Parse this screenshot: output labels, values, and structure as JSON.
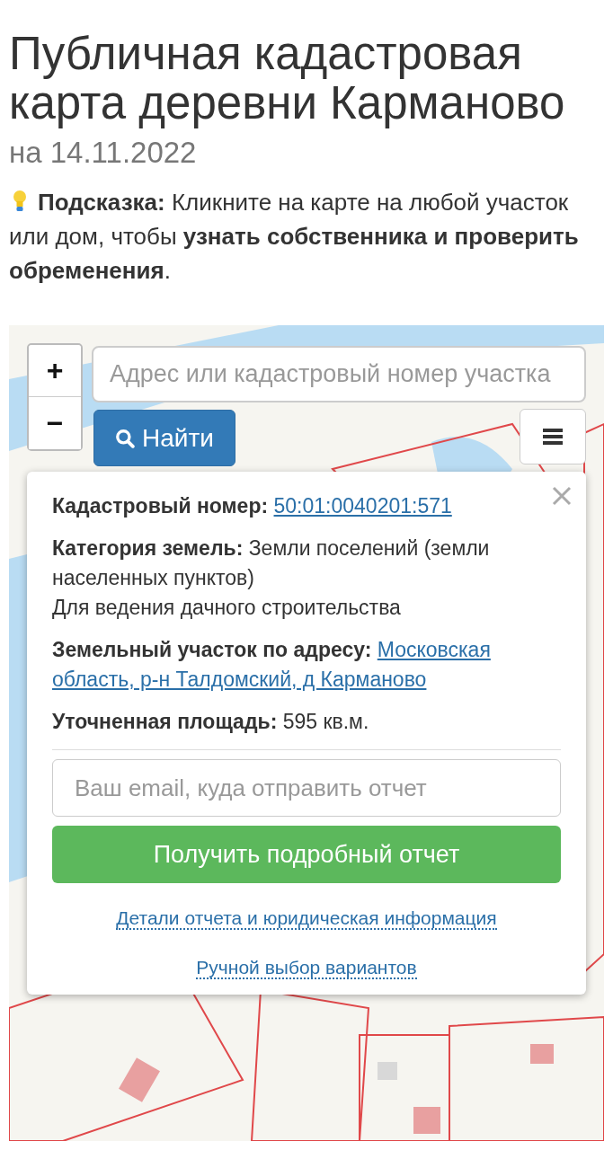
{
  "title": "Публичная кадастровая карта деревни Карманово",
  "date": "на 14.11.2022",
  "hint": "**Подсказка:** Кликните на карте на любой участок или дом, чтобы **узнать собственника и проверить обременения**.",
  "map": {
    "kind": "picture",
    "zoom_in": "+",
    "zoom_out": "−",
    "search": {
      "placeholder": "Адрес или кадастровый номер участка"
    },
    "search_button": "Найти"
  },
  "popup": {
    "fields": [
      {
        "kind": "link",
        "label": "Кадастровый номер:",
        "value": "50:01:0040201:571"
      },
      {
        "kind": "text",
        "label": "Категория земель:",
        "value": "Земли поселений (земли населенных пунктов)",
        "note": "Для ведения дачного строительства"
      },
      {
        "kind": "link",
        "label": "Земельный участок по адресу:",
        "value": "Московская область, р-н Талдомский, д Карманово"
      },
      {
        "kind": "text",
        "label": "Уточненная площадь:",
        "value": "595 кв.м."
      }
    ],
    "email": {
      "placeholder": "Ваш email, куда отправить отчет"
    },
    "submit": "Получить подробный отчет",
    "links": [
      "Детали отчета и юридическая информация",
      "Ручной выбор вариантов"
    ]
  }
}
